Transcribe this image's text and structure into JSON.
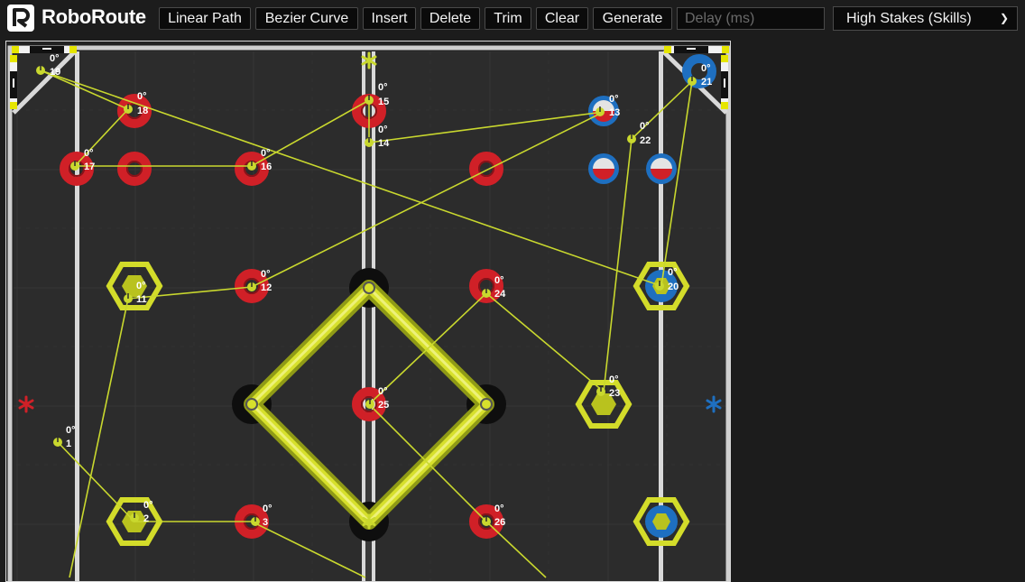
{
  "app": {
    "name": "RoboRoute"
  },
  "toolbar": {
    "buttons": [
      {
        "label": "Linear Path"
      },
      {
        "label": "Bezier Curve"
      },
      {
        "label": "Insert"
      },
      {
        "label": "Delete"
      },
      {
        "label": "Trim"
      },
      {
        "label": "Clear"
      },
      {
        "label": "Generate"
      }
    ],
    "delay_placeholder": "Delay (ms)",
    "field_select": {
      "selected": "High Stakes (Skills)"
    }
  },
  "colors": {
    "background": "#1c1c1c",
    "field_tile": "#2b2b2b",
    "path": "#c9d82e",
    "red_ring": "#d02027",
    "blue_ring": "#1e6fc0",
    "mobile_goal": "#d3dc2a"
  },
  "icons": {
    "logo": "roborouter-logo-icon",
    "dropdown": "chevron-down-icon"
  },
  "waypoints": [
    {
      "id": "1",
      "heading": "0°"
    },
    {
      "id": "2",
      "heading": "0°"
    },
    {
      "id": "3",
      "heading": "0°"
    },
    {
      "id": "11",
      "heading": "0°"
    },
    {
      "id": "12",
      "heading": "0°"
    },
    {
      "id": "13",
      "heading": "0°"
    },
    {
      "id": "14",
      "heading": "0°"
    },
    {
      "id": "15",
      "heading": "0°"
    },
    {
      "id": "16",
      "heading": "0°"
    },
    {
      "id": "17",
      "heading": "0°"
    },
    {
      "id": "18",
      "heading": "0°"
    },
    {
      "id": "19",
      "heading": "0°"
    },
    {
      "id": "20",
      "heading": "0°"
    },
    {
      "id": "21",
      "heading": "0°"
    },
    {
      "id": "22",
      "heading": "0°"
    },
    {
      "id": "23",
      "heading": "0°"
    },
    {
      "id": "24",
      "heading": "0°"
    },
    {
      "id": "25",
      "heading": "0°"
    },
    {
      "id": "26",
      "heading": "0°"
    }
  ]
}
